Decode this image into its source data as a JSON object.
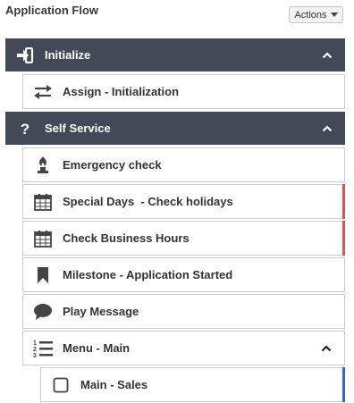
{
  "app": {
    "title": "Application Flow",
    "actions_label": "Actions"
  },
  "colors": {
    "header_bg": "#434956",
    "marker_red": "#d9534f",
    "marker_blue": "#3366cc"
  },
  "sections": [
    {
      "label": "Initialize",
      "icon": "sign-in-icon",
      "expanded": true,
      "items": [
        {
          "label": "Assign - Initialization",
          "icon": "exchange-icon"
        }
      ]
    },
    {
      "label": "Self Service",
      "icon": "question-icon",
      "expanded": true,
      "items": [
        {
          "label": "Emergency check",
          "icon": "fire-extinguisher-icon"
        },
        {
          "label": "Special Days  - Check holidays",
          "icon": "calendar-icon",
          "marker": "red"
        },
        {
          "label": "Check Business Hours",
          "icon": "calendar-icon",
          "marker": "red"
        },
        {
          "label": "Milestone - Application Started",
          "icon": "bookmark-icon"
        },
        {
          "label": "Play Message",
          "icon": "comment-icon"
        },
        {
          "label": "Menu - Main",
          "icon": "ordered-list-icon",
          "expanded": true
        },
        {
          "label": "Main - Sales",
          "icon": "checkbox-icon",
          "marker": "blue"
        }
      ]
    }
  ]
}
